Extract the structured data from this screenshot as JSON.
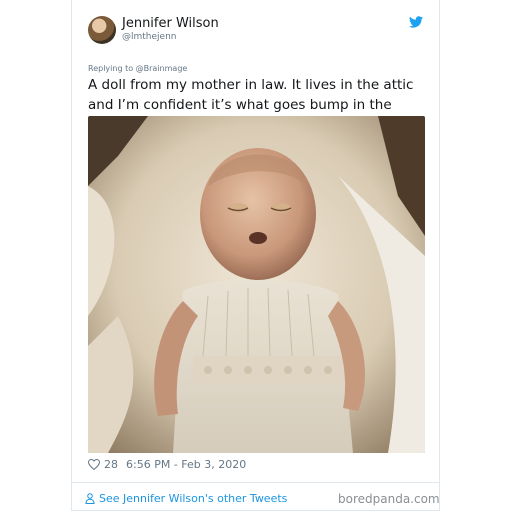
{
  "tweet": {
    "author_name": "Jennifer Wilson",
    "author_handle": "@lmthejenn",
    "replying_to_prefix": "Replying to ",
    "replying_to_handle": "@Brainmage",
    "text": "A doll from my mother in law. It lives in the attic and I’m confident it’s what goes bump in the night.",
    "likes": "28",
    "timestamp": "6:56 PM - Feb 3, 2020",
    "other_tweets_link": "See Jennifer Wilson's other Tweets",
    "photo": "vintage-doll-photo",
    "colors": {
      "accent": "#1da1f2",
      "text": "#14171a",
      "muted": "#657786"
    }
  },
  "watermark": "boredpanda.com"
}
